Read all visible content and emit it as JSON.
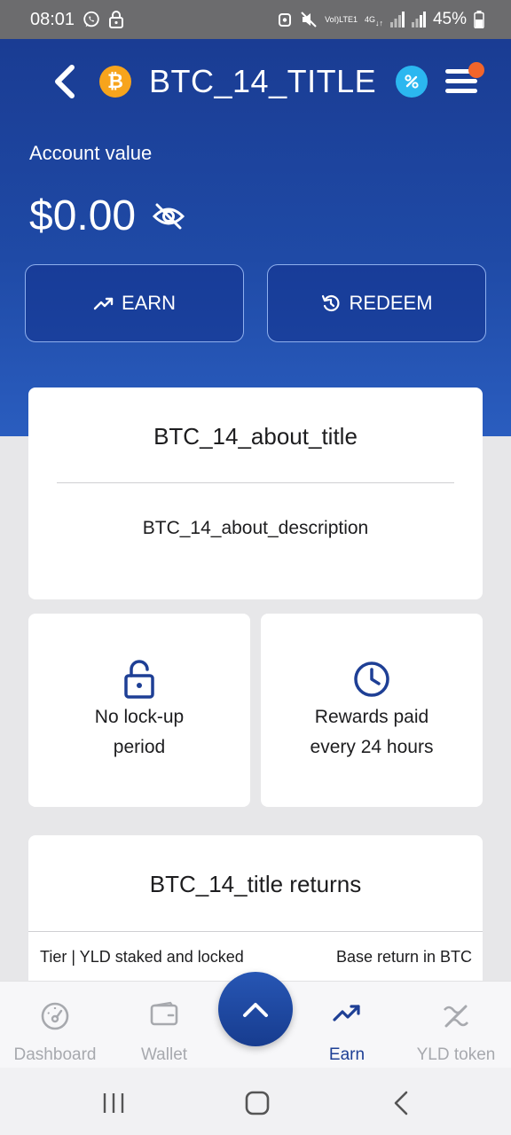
{
  "status_bar": {
    "time": "08:01",
    "lte_top": "VoI)",
    "lte_bottom": "LTE1",
    "net_top": "4G",
    "battery": "45%"
  },
  "header": {
    "title": "BTC_14_TITLE",
    "coin_symbol": "₿"
  },
  "account": {
    "label": "Account value",
    "value": "$0.00"
  },
  "actions": {
    "earn_label": "EARN",
    "redeem_label": "REDEEM"
  },
  "about": {
    "title": "BTC_14_about_title",
    "description": "BTC_14_about_description"
  },
  "features": {
    "lock": {
      "line1": "No lock-up",
      "line2": "period"
    },
    "rewards": {
      "line1": "Rewards paid",
      "line2": "every 24 hours"
    }
  },
  "returns": {
    "title": "BTC_14_title returns",
    "col_left": "Tier | YLD staked and locked",
    "col_right": "Base return in BTC"
  },
  "bottom_nav": {
    "dashboard": "Dashboard",
    "wallet": "Wallet",
    "earn": "Earn",
    "yld": "YLD token"
  },
  "colors": {
    "primary": "#1e3f95",
    "btc_orange": "#f7a41c",
    "percent_blue": "#2bb7f0",
    "notification": "#f2652a",
    "inactive": "#a7a9ae"
  }
}
